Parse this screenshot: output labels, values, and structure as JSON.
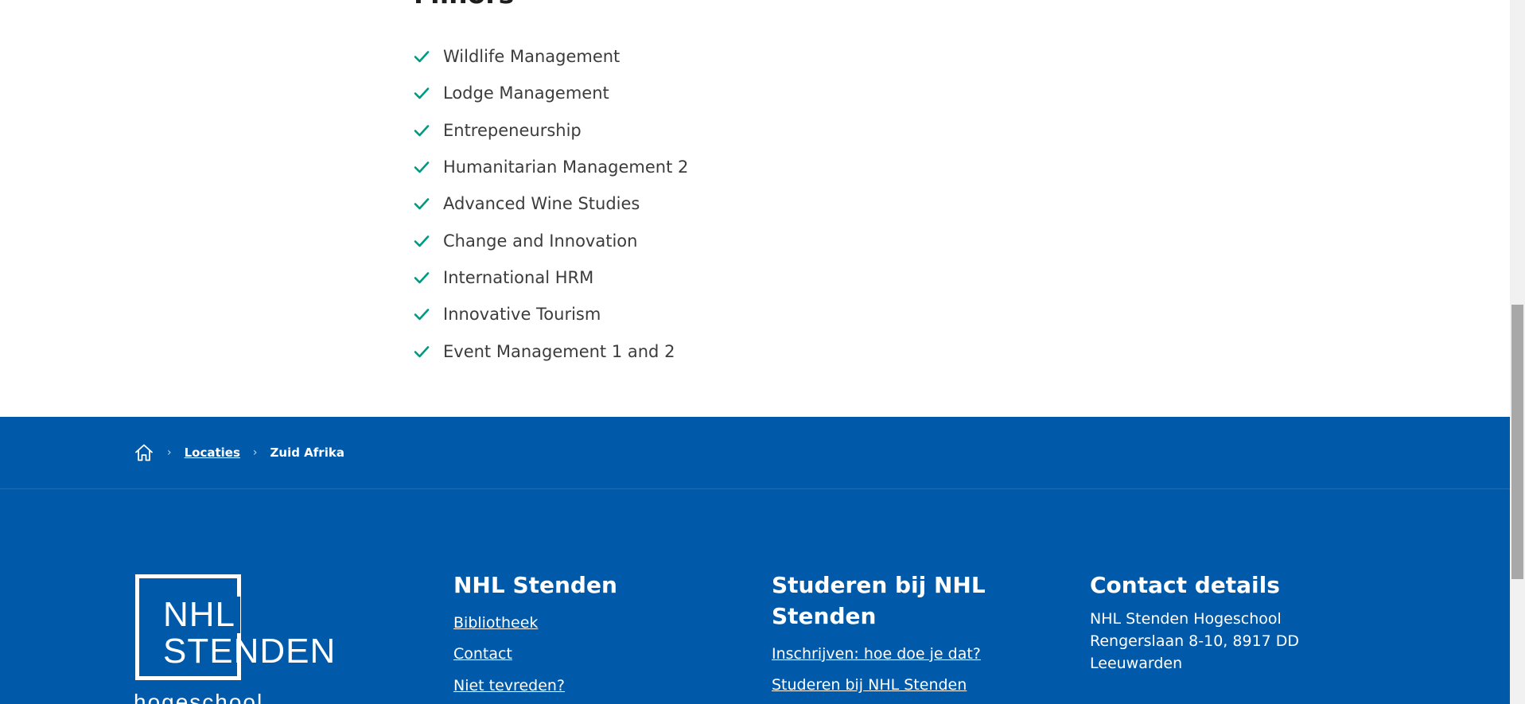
{
  "minors": {
    "title": "Minors",
    "items": [
      "Wildlife Management",
      "Lodge Management",
      "Entrepeneurship",
      "Humanitarian Management 2",
      "Advanced Wine Studies",
      "Change and Innovation",
      "International HRM",
      "Innovative Tourism",
      "Event Management 1 and 2"
    ]
  },
  "breadcrumb": {
    "home_icon": "home-icon",
    "separator": "›",
    "locaties": "Locaties",
    "current": "Zuid Afrika"
  },
  "footer": {
    "logo": {
      "line1": "NHL",
      "line2": "STENDEN",
      "sub": "hogeschool"
    },
    "col1": {
      "title": "NHL Stenden",
      "links": [
        "Bibliotheek",
        "Contact",
        "Niet tevreden?"
      ]
    },
    "col2": {
      "title": "Studeren bij NHL Stenden",
      "links": [
        "Inschrijven: hoe doe je dat?",
        "Studeren bij NHL Stenden"
      ]
    },
    "col3": {
      "title": "Contact details",
      "lines": [
        "NHL Stenden Hogeschool",
        "Rengerslaan 8-10, 8917 DD",
        "Leeuwarden"
      ]
    }
  },
  "colors": {
    "footer_bg": "#005aa9",
    "check": "#009a82",
    "text": "#3c3c3c",
    "white": "#ffffff"
  }
}
